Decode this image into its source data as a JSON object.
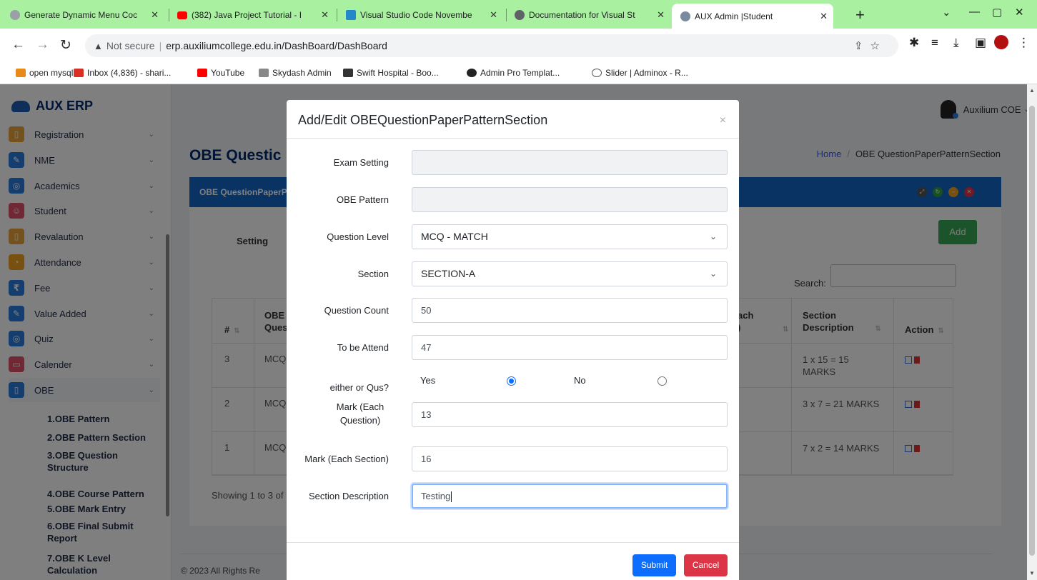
{
  "browser": {
    "tabs": [
      {
        "title": "Generate Dynamic Menu Coc",
        "favicon_color": "#9aa0a6"
      },
      {
        "title": "(382) Java Project Tutorial - I",
        "favicon_color": "#ff0000"
      },
      {
        "title": "Visual Studio Code Novembe",
        "favicon_color": "#2489ca"
      },
      {
        "title": "Documentation for Visual St",
        "favicon_color": "#5f6368"
      },
      {
        "title": "AUX Admin |Student",
        "favicon_color": "#7a8aa0"
      }
    ],
    "new_tab": "+",
    "window_controls": [
      "⌄",
      "—",
      "▢",
      "✕"
    ],
    "address": {
      "not_secure": "Not secure",
      "url": "erp.auxiliumcollege.edu.in/DashBoard/DashBoard"
    },
    "bookmarks": [
      {
        "label": "open mysql",
        "color": "#e88a1a"
      },
      {
        "label": "Inbox (4,836) - shari...",
        "color": "#d93025"
      },
      {
        "label": "YouTube",
        "color": "#ff0000"
      },
      {
        "label": "Skydash Admin",
        "color": "#888888"
      },
      {
        "label": "Swift Hospital - Boo...",
        "color": "#333333"
      },
      {
        "label": "Admin Pro Templat...",
        "color": "#222222"
      },
      {
        "label": "Slider | Adminox - R...",
        "color": "#555555"
      }
    ]
  },
  "app": {
    "brand": "AUX ERP",
    "user": "Auxilium COE",
    "sidebar": {
      "items": [
        {
          "label": "Registration",
          "color": "#e8a23a",
          "glyph": "▯"
        },
        {
          "label": "NME",
          "color": "#2b7de0",
          "glyph": "✎"
        },
        {
          "label": "Academics",
          "color": "#2b7de0",
          "glyph": "◎"
        },
        {
          "label": "Student",
          "color": "#e2506a",
          "glyph": "☺"
        },
        {
          "label": "Revalaution",
          "color": "#e8a23a",
          "glyph": "▯"
        },
        {
          "label": "Attendance",
          "color": "#f0a020",
          "glyph": "◔"
        },
        {
          "label": "Fee",
          "color": "#2b7de0",
          "glyph": "₹"
        },
        {
          "label": "Value Added",
          "color": "#2b7de0",
          "glyph": "✎"
        },
        {
          "label": "Quiz",
          "color": "#2b7de0",
          "glyph": "◎"
        },
        {
          "label": "Calender",
          "color": "#e2506a",
          "glyph": "▭"
        },
        {
          "label": "OBE",
          "color": "#2b7de0",
          "glyph": "▯"
        }
      ],
      "sub_items": [
        "1.OBE Pattern",
        "2.OBE Pattern Section",
        "3.OBE Question Structure",
        "4.OBE Course Pattern",
        "5.OBE Mark Entry",
        "6.OBE Final Submit Report",
        "7.OBE K Level Calculation"
      ]
    },
    "page_title": "OBE Questic",
    "breadcrumb": {
      "home": "Home",
      "sep": "/",
      "current": "OBE QuestionPaperPatternSection"
    },
    "card_title": "OBE QuestionPaperPa",
    "setting_label": "Setting",
    "add_label": "Add",
    "search_label": "Search:",
    "table": {
      "headers": {
        "num": "#",
        "obe_l1": "OBE",
        "obe_l2": "Ques",
        "each_l1": "ach",
        "each_l2": ")",
        "desc_l1": "Section",
        "desc_l2": "Description",
        "action": "Action"
      },
      "rows": [
        {
          "num": "3",
          "obe": "MCQ",
          "desc_l1": "1 x 15 = 15",
          "desc_l2": "MARKS"
        },
        {
          "num": "2",
          "obe": "MCQ",
          "desc_l1": "3 x 7 = 21 MARKS",
          "desc_l2": ""
        },
        {
          "num": "1",
          "obe": "MCQ",
          "desc_l1": "7 x 2 = 14 MARKS",
          "desc_l2": ""
        }
      ]
    },
    "showing": "Showing 1 to 3 of",
    "footer": "© 2023 All Rights Re"
  },
  "modal": {
    "title": "Add/Edit OBEQuestionPaperPatternSection",
    "close": "×",
    "fields": {
      "exam_setting": {
        "label": "Exam Setting",
        "value": ""
      },
      "obe_pattern": {
        "label": "OBE Pattern",
        "value": ""
      },
      "question_level": {
        "label": "Question Level",
        "value": "MCQ - MATCH"
      },
      "section": {
        "label": "Section",
        "value": "SECTION-A"
      },
      "question_count": {
        "label": "Question Count",
        "value": "50"
      },
      "to_be_attend": {
        "label": "To be Attend",
        "value": "47"
      },
      "either_or": {
        "label": "either or Qus?",
        "yes": "Yes",
        "no": "No",
        "selected": "yes"
      },
      "mark_each_question": {
        "label_l1": "Mark (Each",
        "label_l2": "Question)",
        "value": "13"
      },
      "mark_each_section": {
        "label": "Mark (Each Section)",
        "value": "16"
      },
      "section_description": {
        "label": "Section Description",
        "value": "Testing"
      }
    },
    "submit": "Submit",
    "cancel": "Cancel"
  }
}
